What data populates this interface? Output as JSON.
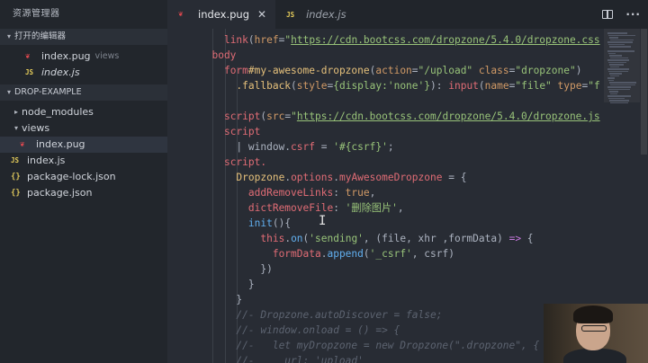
{
  "explorer": {
    "title": "资源管理器",
    "open_editors": {
      "label": "打开的编辑器",
      "items": [
        {
          "name": "index.pug",
          "desc": "views",
          "icon": "pug-file-icon"
        },
        {
          "name": "index.js",
          "desc": "",
          "icon": "js-file-icon"
        }
      ]
    },
    "project": {
      "label": "DROP-EXAMPLE",
      "items": [
        {
          "name": "node_modules",
          "type": "folder",
          "expanded": false
        },
        {
          "name": "views",
          "type": "folder",
          "expanded": true
        },
        {
          "name": "index.pug",
          "type": "pug",
          "selected": true
        },
        {
          "name": "index.js",
          "type": "js"
        },
        {
          "name": "package-lock.json",
          "type": "json"
        },
        {
          "name": "package.json",
          "type": "json"
        }
      ]
    }
  },
  "icons": {
    "js": "JS",
    "json": "{}",
    "pug": "❦",
    "chevron_down": "▾",
    "chevron_right": "▸",
    "close": "✕",
    "more": "···"
  },
  "tabs": [
    {
      "label": "index.pug",
      "active": true
    },
    {
      "label": "index.js",
      "active": false
    }
  ],
  "code_lines": [
    [
      [
        "t-plain",
        "    "
      ],
      [
        "t-tag",
        "link"
      ],
      [
        "t-plain",
        "("
      ],
      [
        "t-attr",
        "href"
      ],
      [
        "t-plain",
        "="
      ],
      [
        "t-str",
        "\""
      ],
      [
        "t-url",
        "https://cdn.bootcss.com/dropzone/5.4.0/dropzone.css"
      ]
    ],
    [
      [
        "t-tag",
        "  body"
      ]
    ],
    [
      [
        "t-plain",
        "    "
      ],
      [
        "t-tag",
        "form"
      ],
      [
        "t-cls",
        "#my-awesome-dropzone"
      ],
      [
        "t-plain",
        "("
      ],
      [
        "t-attr",
        "action"
      ],
      [
        "t-plain",
        "="
      ],
      [
        "t-str",
        "\"/upload\""
      ],
      [
        "t-plain",
        " "
      ],
      [
        "t-attr",
        "class"
      ],
      [
        "t-plain",
        "="
      ],
      [
        "t-str",
        "\"dropzone\""
      ],
      [
        "t-plain",
        ")"
      ]
    ],
    [
      [
        "t-plain",
        "      "
      ],
      [
        "t-cls",
        ".fallback"
      ],
      [
        "t-plain",
        "("
      ],
      [
        "t-attr",
        "style"
      ],
      [
        "t-plain",
        "="
      ],
      [
        "t-str",
        "{display:'none'}"
      ],
      [
        "t-plain",
        "): "
      ],
      [
        "t-tag",
        "input"
      ],
      [
        "t-plain",
        "("
      ],
      [
        "t-attr",
        "name"
      ],
      [
        "t-plain",
        "="
      ],
      [
        "t-str",
        "\"file\""
      ],
      [
        "t-plain",
        " "
      ],
      [
        "t-attr",
        "type"
      ],
      [
        "t-plain",
        "="
      ],
      [
        "t-str",
        "\"f"
      ]
    ],
    [
      [
        "t-plain",
        ""
      ]
    ],
    [
      [
        "t-plain",
        "    "
      ],
      [
        "t-tag",
        "script"
      ],
      [
        "t-plain",
        "("
      ],
      [
        "t-attr",
        "src"
      ],
      [
        "t-plain",
        "="
      ],
      [
        "t-str",
        "\""
      ],
      [
        "t-url",
        "https://cdn.bootcss.com/dropzone/5.4.0/dropzone.js"
      ]
    ],
    [
      [
        "t-plain",
        "    "
      ],
      [
        "t-tag",
        "script"
      ]
    ],
    [
      [
        "t-plain",
        "      | window."
      ],
      [
        "t-prop",
        "csrf"
      ],
      [
        "t-plain",
        " = "
      ],
      [
        "t-str",
        "'#{csrf}'"
      ],
      [
        "t-plain",
        ";"
      ]
    ],
    [
      [
        "t-plain",
        "    "
      ],
      [
        "t-tag",
        "script."
      ]
    ],
    [
      [
        "t-plain",
        "      "
      ],
      [
        "t-cls",
        "Dropzone"
      ],
      [
        "t-plain",
        "."
      ],
      [
        "t-prop",
        "options"
      ],
      [
        "t-plain",
        "."
      ],
      [
        "t-prop",
        "myAwesomeDropzone"
      ],
      [
        "t-plain",
        " = {"
      ]
    ],
    [
      [
        "t-plain",
        "        "
      ],
      [
        "t-prop",
        "addRemoveLinks"
      ],
      [
        "t-plain",
        ": "
      ],
      [
        "t-attr",
        "true"
      ],
      [
        "t-plain",
        ","
      ]
    ],
    [
      [
        "t-plain",
        "        "
      ],
      [
        "t-prop",
        "dictRemoveFile"
      ],
      [
        "t-plain",
        ": "
      ],
      [
        "t-str",
        "'删除图片'"
      ],
      [
        "t-plain",
        ","
      ]
    ],
    [
      [
        "t-plain",
        "        "
      ],
      [
        "t-fn",
        "init"
      ],
      [
        "t-plain",
        "(){"
      ]
    ],
    [
      [
        "t-plain",
        "          "
      ],
      [
        "t-tag",
        "this"
      ],
      [
        "t-plain",
        "."
      ],
      [
        "t-fn",
        "on"
      ],
      [
        "t-plain",
        "("
      ],
      [
        "t-str",
        "'sending'"
      ],
      [
        "t-plain",
        ", (file, xhr ,formData) "
      ],
      [
        "t-kw",
        "=>"
      ],
      [
        "t-plain",
        " {"
      ]
    ],
    [
      [
        "t-plain",
        "            "
      ],
      [
        "t-prop",
        "formData"
      ],
      [
        "t-plain",
        "."
      ],
      [
        "t-fn",
        "append"
      ],
      [
        "t-plain",
        "("
      ],
      [
        "t-str",
        "'_csrf'"
      ],
      [
        "t-plain",
        ", csrf)"
      ]
    ],
    [
      [
        "t-plain",
        "          })"
      ]
    ],
    [
      [
        "t-plain",
        "        }"
      ]
    ],
    [
      [
        "t-plain",
        "      }"
      ]
    ],
    [
      [
        "t-plain",
        "      "
      ],
      [
        "t-cmt",
        "//- Dropzone.autoDiscover = false;"
      ]
    ],
    [
      [
        "t-plain",
        "      "
      ],
      [
        "t-cmt",
        "//- window.onload = () => {"
      ]
    ],
    [
      [
        "t-plain",
        "      "
      ],
      [
        "t-cmt",
        "//-   let myDropzone = new Dropzone(\".dropzone\", {"
      ]
    ],
    [
      [
        "t-plain",
        "      "
      ],
      [
        "t-cmt",
        "//-     url: 'upload'"
      ]
    ]
  ]
}
